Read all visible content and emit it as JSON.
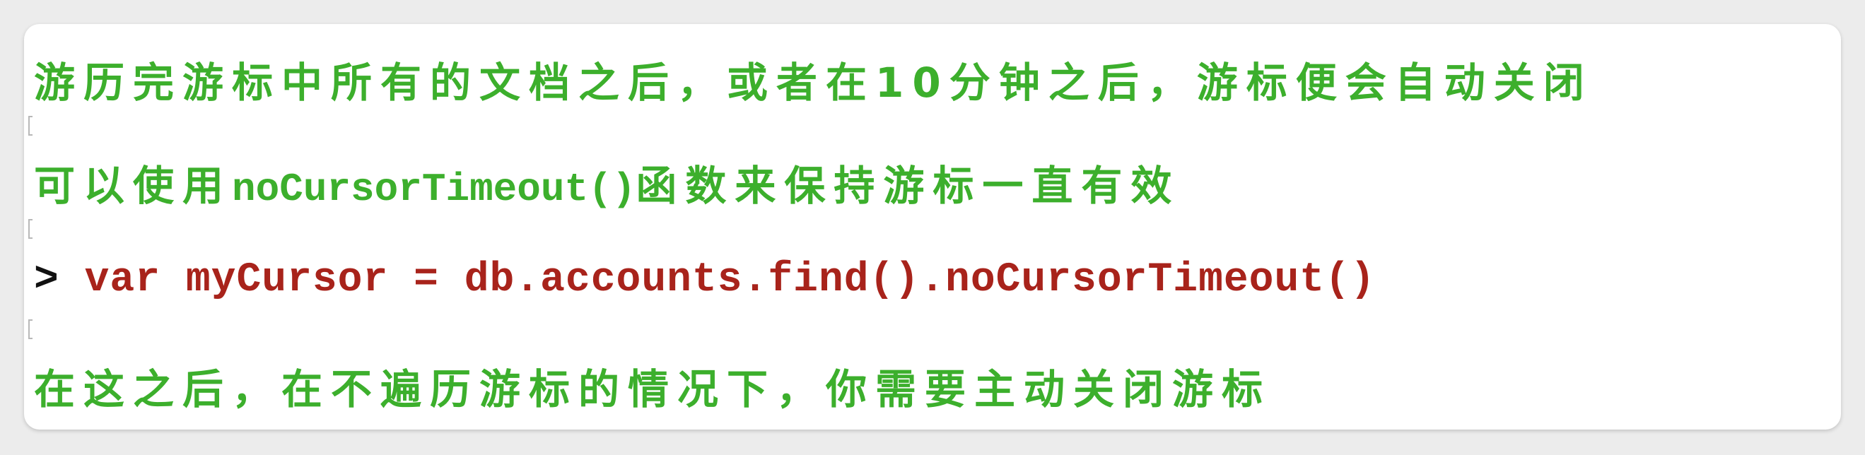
{
  "lines": {
    "line1": "游历完游标中所有的文档之后，或者在10分钟之后，游标便会自动关闭",
    "line2_prefix": "可以使用",
    "line2_code": "noCursorTimeout()",
    "line2_suffix": "函数来保持游标一直有效",
    "line3_prompt": ">",
    "line3_code": "var myCursor = db.accounts.find().noCursorTimeout()",
    "line4": "在这之后，在不遍历游标的情况下，你需要主动关闭游标"
  },
  "colors": {
    "explanation_text": "#3caf2c",
    "code_text": "#a8231b",
    "prompt": "#111111",
    "card_background": "#ffffff",
    "page_background": "#ececec"
  }
}
